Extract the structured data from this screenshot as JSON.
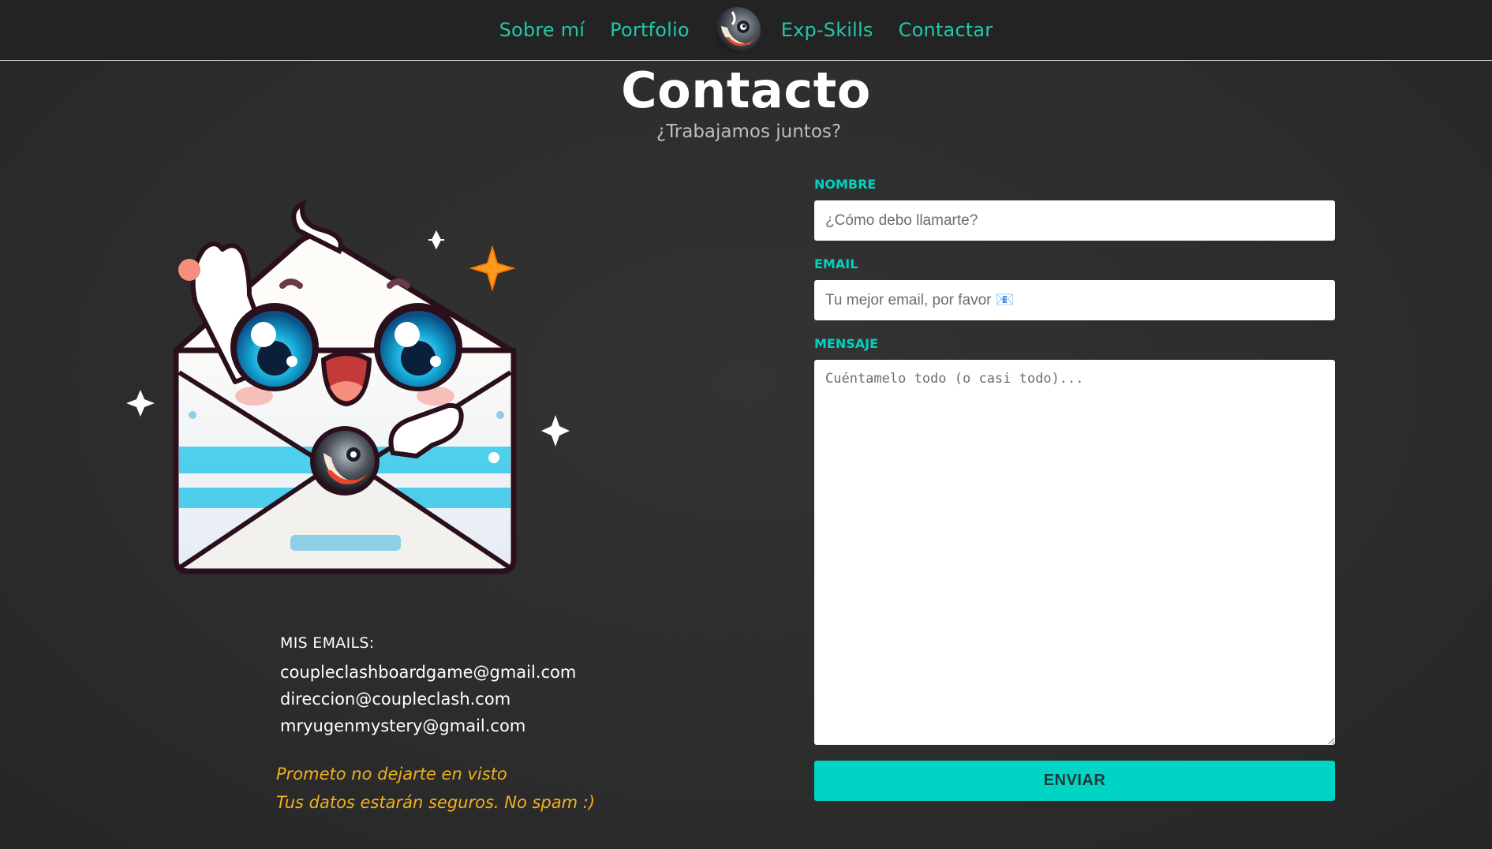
{
  "nav": {
    "items_left": [
      "Sobre mí",
      "Portfolio"
    ],
    "items_right": [
      "Exp-Skills",
      "Contactar"
    ],
    "logo_icon": "eye-logo-icon",
    "link_color": "#22c7a9"
  },
  "header": {
    "title": "Contacto",
    "subtitle": "¿Trabajamos juntos?"
  },
  "illustration": {
    "icon": "envelope-mascot-icon"
  },
  "emails": {
    "label": "MIS EMAILS:",
    "list": [
      "coupleclashboardgame@gmail.com",
      "direccion@coupleclash.com",
      "mryugenmystery@gmail.com"
    ]
  },
  "promise": {
    "line1": "Prometo no dejarte en visto",
    "line2": "Tus datos estarán seguros. No spam :)",
    "color": "#f0b020"
  },
  "form": {
    "name_label": "NOMBRE",
    "name_placeholder": "¿Cómo debo llamarte?",
    "email_label": "EMAIL",
    "email_placeholder": "Tu mejor email, por favor 📧",
    "message_label": "MENSAJE",
    "message_placeholder": "Cuéntamelo todo (o casi todo)...",
    "submit_label": "ENVIAR",
    "accent": "#00d4c4"
  }
}
